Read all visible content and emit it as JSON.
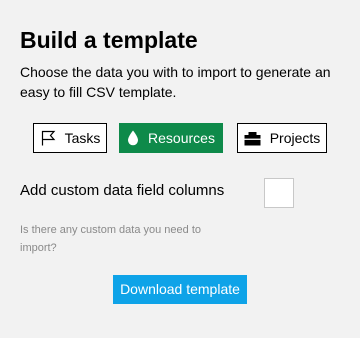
{
  "header": {
    "title": "Build a template",
    "description": "Choose the data you with to import to generate an easy to fill CSV template."
  },
  "data_types": {
    "selected": "Resources",
    "selected_color": "#0e8a4a",
    "items": [
      {
        "label": "Tasks",
        "icon": "flag-icon"
      },
      {
        "label": "Resources",
        "icon": "drop-icon"
      },
      {
        "label": "Projects",
        "icon": "briefcase-icon"
      }
    ]
  },
  "custom_fields": {
    "label": "Add custom data field columns",
    "help": "Is there any custom data you need to import?",
    "checked": false
  },
  "actions": {
    "download_label": "Download template",
    "download_color": "#0ea3e8"
  }
}
